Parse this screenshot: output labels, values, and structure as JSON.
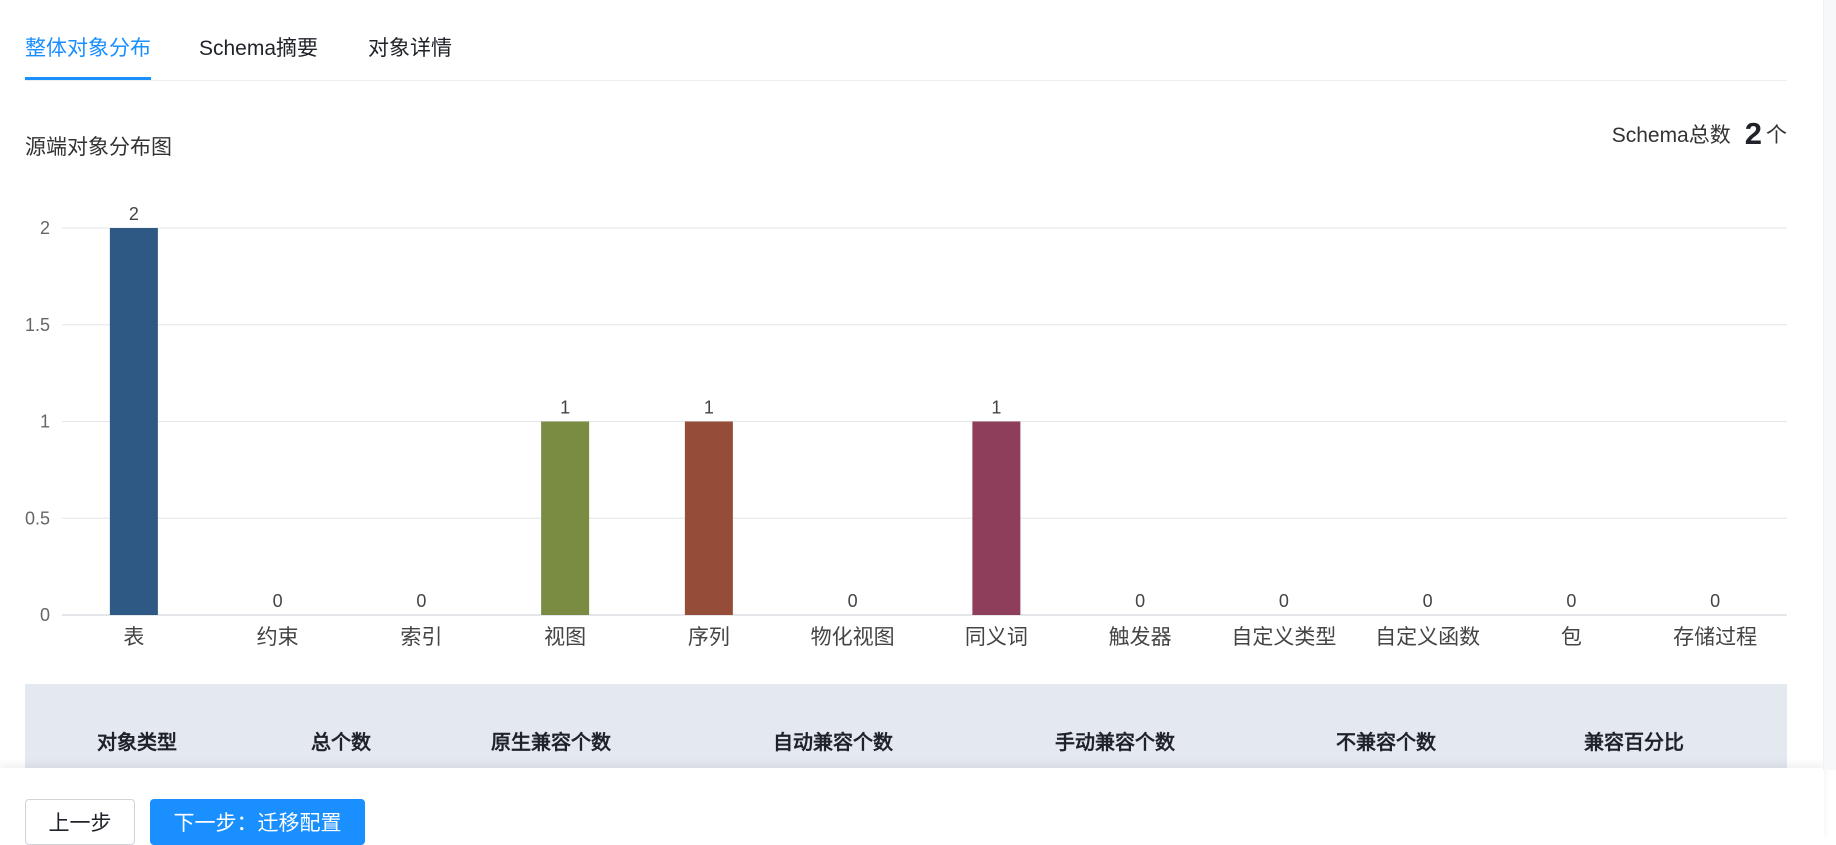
{
  "tabs": [
    {
      "label": "整体对象分布",
      "active": true
    },
    {
      "label": "Schema摘要",
      "active": false
    },
    {
      "label": "对象详情",
      "active": false
    }
  ],
  "chart_section": {
    "title": "源端对象分布图",
    "schema_total_label": "Schema总数",
    "schema_total_value": "2",
    "schema_total_unit": "个"
  },
  "chart_data": {
    "type": "bar",
    "categories": [
      "表",
      "约束",
      "索引",
      "视图",
      "序列",
      "物化视图",
      "同义词",
      "触发器",
      "自定义类型",
      "自定义函数",
      "包",
      "存储过程"
    ],
    "values": [
      2,
      0,
      0,
      1,
      1,
      0,
      1,
      0,
      0,
      0,
      0,
      0
    ],
    "colors": [
      "#2e5984",
      "#2e5984",
      "#2e5984",
      "#7a8b42",
      "#954d3a",
      "#954d3a",
      "#8e3d5a",
      "#8e3d5a",
      "#8e3d5a",
      "#8e3d5a",
      "#8e3d5a",
      "#8e3d5a"
    ],
    "yticks": [
      "0",
      "0.5",
      "1",
      "1.5",
      "2"
    ],
    "ylim": [
      0,
      2
    ],
    "grid": true
  },
  "table": {
    "headers": [
      "对象类型",
      "总个数",
      "原生兼容个数",
      "自动兼容个数",
      "手动兼容个数",
      "不兼容个数",
      "兼容百分比"
    ]
  },
  "footer": {
    "prev_label": "上一步",
    "next_label": "下一步：迁移配置"
  },
  "colors": {
    "accent": "#1a8fff",
    "table_header_bg": "#e4e8ef"
  }
}
